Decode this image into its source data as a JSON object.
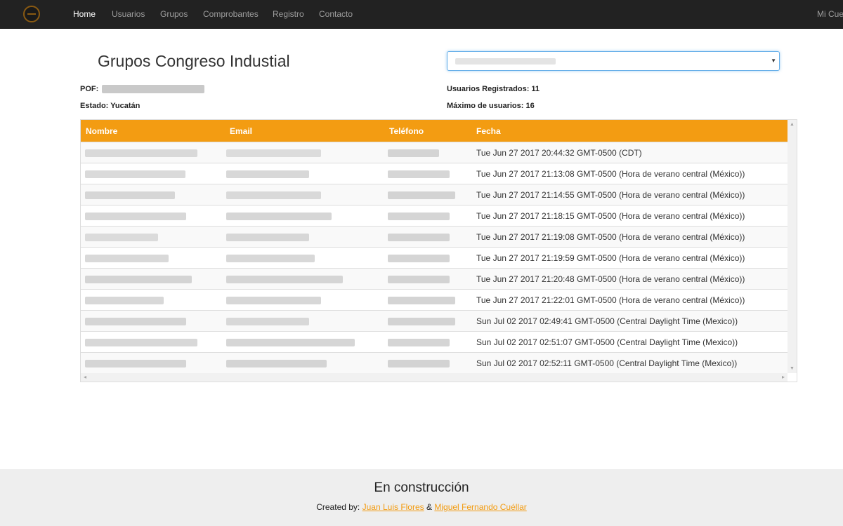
{
  "nav": {
    "items": [
      {
        "label": "Home",
        "active": true
      },
      {
        "label": "Usuarios",
        "active": false
      },
      {
        "label": "Grupos",
        "active": false
      },
      {
        "label": "Comprobantes",
        "active": false
      },
      {
        "label": "Registro",
        "active": false
      },
      {
        "label": "Contacto",
        "active": false
      }
    ],
    "account_label": "Mi Cuenta"
  },
  "page": {
    "title": "Grupos Congreso Industial"
  },
  "info": {
    "pof_label": "POF:",
    "estado": "Estado: Yucatán",
    "usuarios_registrados": "Usuarios Registrados: 11",
    "maximo_usuarios": "Máximo de usuarios: 16"
  },
  "table": {
    "headers": {
      "nombre": "Nombre",
      "email": "Email",
      "telefono": "Teléfono",
      "fecha": "Fecha"
    },
    "rows": [
      {
        "fecha": "Tue Jun 27 2017 20:44:32 GMT-0500 (CDT)"
      },
      {
        "fecha": "Tue Jun 27 2017 21:13:08 GMT-0500 (Hora de verano central (México))"
      },
      {
        "fecha": "Tue Jun 27 2017 21:14:55 GMT-0500 (Hora de verano central (México))"
      },
      {
        "fecha": "Tue Jun 27 2017 21:18:15 GMT-0500 (Hora de verano central (México))"
      },
      {
        "fecha": "Tue Jun 27 2017 21:19:08 GMT-0500 (Hora de verano central (México))"
      },
      {
        "fecha": "Tue Jun 27 2017 21:19:59 GMT-0500 (Hora de verano central (México))"
      },
      {
        "fecha": "Tue Jun 27 2017 21:20:48 GMT-0500 (Hora de verano central (México))"
      },
      {
        "fecha": "Tue Jun 27 2017 21:22:01 GMT-0500 (Hora de verano central (México))"
      },
      {
        "fecha": "Sun Jul 02 2017 02:49:41 GMT-0500 (Central Daylight Time (Mexico))"
      },
      {
        "fecha": "Sun Jul 02 2017 02:51:07 GMT-0500 (Central Daylight Time (Mexico))"
      },
      {
        "fecha": "Sun Jul 02 2017 02:52:11 GMT-0500 (Central Daylight Time (Mexico))"
      }
    ]
  },
  "footer": {
    "title": "En construcción",
    "created_by": "Created by:",
    "author1": "Juan Luis Flores",
    "separator": "&",
    "author2": "Miguel Fernando Cuéllar"
  },
  "colors": {
    "navbar": "#222222",
    "accent": "#f39c12",
    "footer": "#eeeeee"
  }
}
